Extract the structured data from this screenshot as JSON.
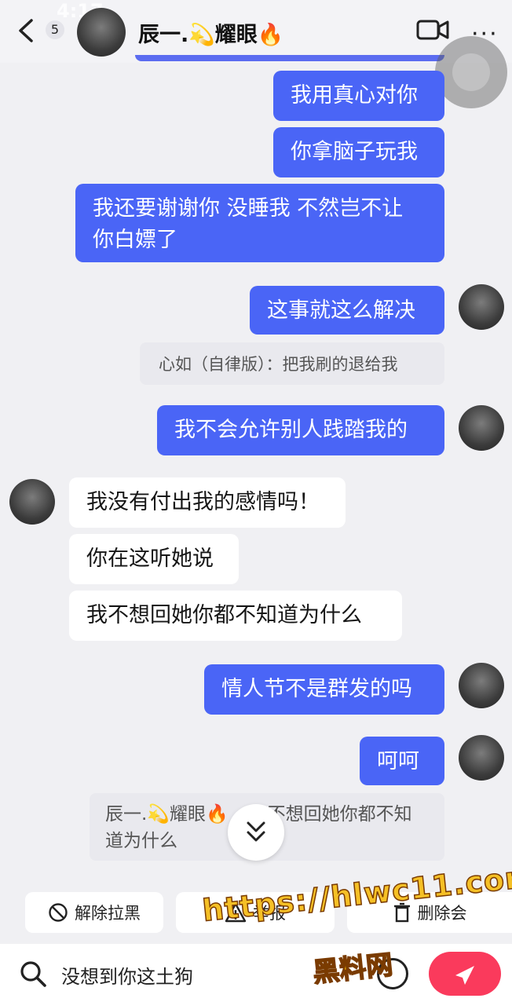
{
  "header": {
    "status_time": "4:17",
    "unread_count": "5",
    "contact_name": "辰一.💫耀眼🔥"
  },
  "messages": [
    {
      "side": "out",
      "text": "我用真心对你"
    },
    {
      "side": "out",
      "text": "你拿脑子玩我"
    },
    {
      "side": "out",
      "text": "我还要谢谢你 没睡我 不然岂不让\n你白嫖了"
    },
    {
      "side": "out",
      "text": "这事就这么解决"
    },
    {
      "side": "quote",
      "text": "心如（自律版）：把我刷的退给我"
    },
    {
      "side": "out",
      "text": "我不会允许别人践踏我的"
    },
    {
      "side": "in",
      "text": "我没有付出我的感情吗！"
    },
    {
      "side": "in",
      "text": "你在这听她说"
    },
    {
      "side": "in",
      "text": "我不想回她你都不知道为什么"
    },
    {
      "side": "out",
      "text": "情人节不是群发的吗"
    },
    {
      "side": "out",
      "text": "呵呵"
    }
  ],
  "reply_quote": {
    "line1": "辰一.💫耀眼🔥",
    "line1_rest": "不想回她你都不知",
    "line2": "道为什么"
  },
  "actions": {
    "unblock": "解除拉黑",
    "report": "举报",
    "delete": "删除会"
  },
  "input": {
    "value": "没想到你这土狗"
  },
  "watermark": {
    "url": "https://hlwc11.com",
    "text": "黑料网"
  },
  "colors": {
    "outgoing_bubble": "#4a65f6",
    "incoming_bubble": "#ffffff",
    "send_button": "#fa3a5c"
  }
}
